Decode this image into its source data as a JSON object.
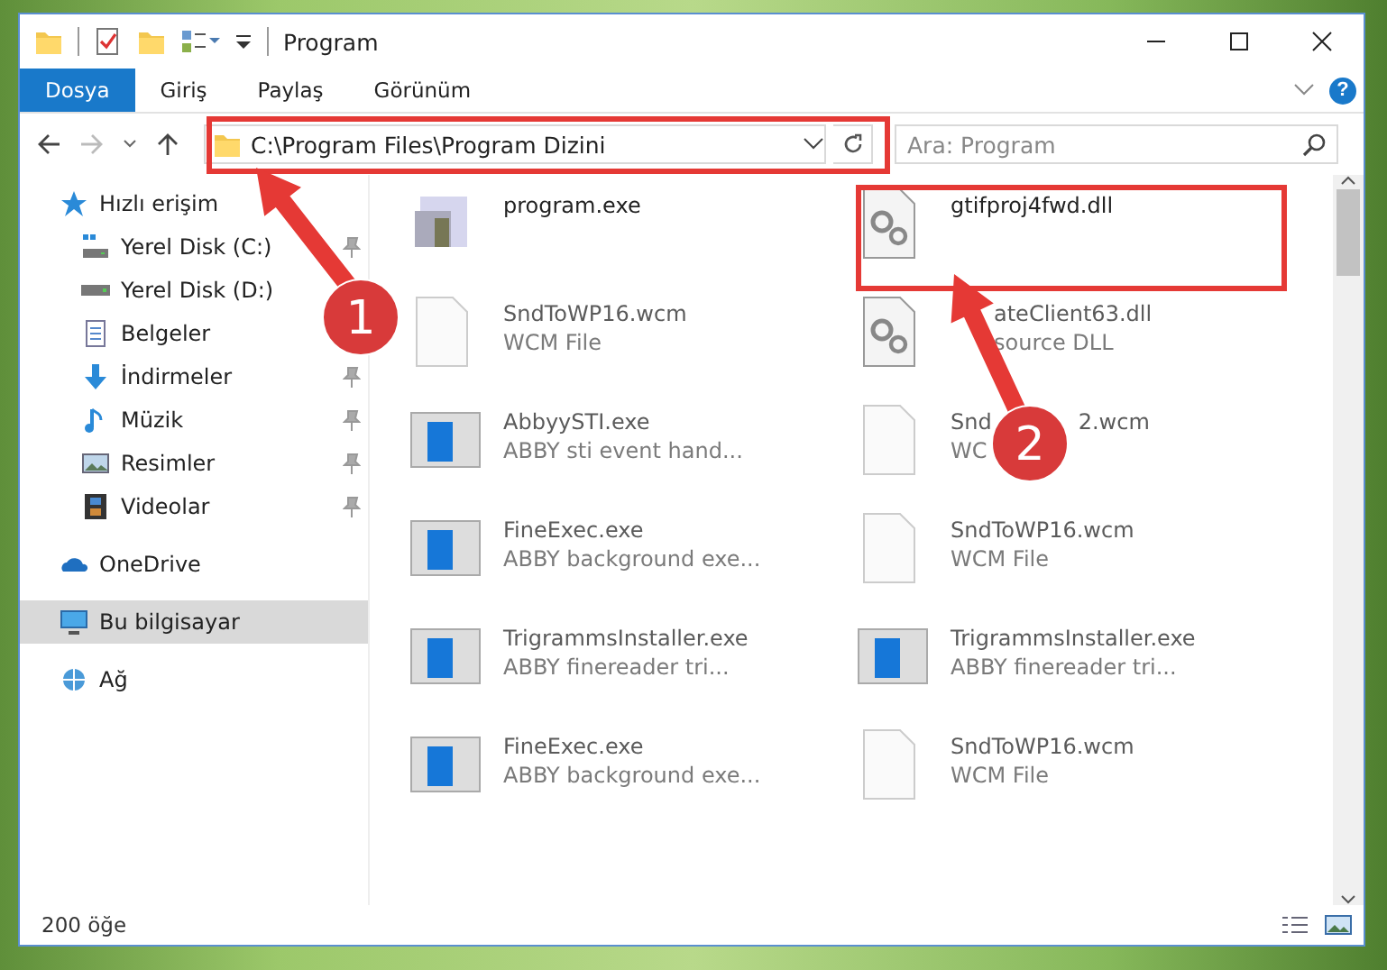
{
  "window": {
    "title": "Program"
  },
  "ribbon_tabs": [
    {
      "label": "Dosya",
      "selected": true
    },
    {
      "label": "Giriş",
      "selected": false
    },
    {
      "label": "Paylaş",
      "selected": false
    },
    {
      "label": "Görünüm",
      "selected": false
    }
  ],
  "help": "?",
  "address": {
    "path": "C:\\Program Files\\Program Dizini"
  },
  "search": {
    "placeholder": "Ara: Program"
  },
  "sidebar": {
    "groups": [
      {
        "label": "Hızlı erişim",
        "selected": false,
        "children": [
          {
            "label": "Yerel Disk (C:)",
            "pinned": true
          },
          {
            "label": "Yerel Disk (D:)"
          },
          {
            "label": "Belgeler"
          },
          {
            "label": "İndirmeler",
            "pinned": true
          },
          {
            "label": "Müzik",
            "pinned": true
          },
          {
            "label": "Resimler",
            "pinned": true
          },
          {
            "label": "Videolar",
            "pinned": true
          }
        ]
      },
      {
        "label": "OneDrive",
        "selected": false
      },
      {
        "label": "Bu bilgisayar",
        "selected": true
      },
      {
        "label": "Ağ",
        "selected": false
      }
    ]
  },
  "files": {
    "columns": [
      [
        {
          "kind": "installer",
          "name": "program.exe"
        },
        {
          "kind": "blank",
          "name": "SndToWP16.wcm",
          "detail": "WCM File"
        },
        {
          "kind": "app",
          "name": "AbbyySTI.exe",
          "detail": "ABBY sti event hand..."
        },
        {
          "kind": "app",
          "name": "FineExec.exe",
          "detail": "ABBY background exe..."
        },
        {
          "kind": "app",
          "name": "TrigrammsInstaller.exe",
          "detail": "ABBY finereader tri..."
        },
        {
          "kind": "app",
          "name": "FineExec.exe",
          "detail": "ABBY background exe..."
        }
      ],
      [
        {
          "kind": "dll",
          "name": "gtifproj4fwd.dll"
        },
        {
          "kind": "dll",
          "name": "ateClient63.dll",
          "detail": "source DLL"
        },
        {
          "kind": "blank",
          "name_parts": [
            "Snd",
            "2.wcm"
          ],
          "detail": "WC"
        },
        {
          "kind": "blank",
          "name": "SndToWP16.wcm",
          "detail": "WCM File"
        },
        {
          "kind": "app",
          "name": "TrigrammsInstaller.exe",
          "detail": "ABBY finereader tri..."
        },
        {
          "kind": "blank",
          "name": "SndToWP16.wcm",
          "detail": "WCM File"
        }
      ]
    ]
  },
  "status_bar": {
    "count": "200 öğe"
  },
  "annotations": [
    {
      "number": "1"
    },
    {
      "number": "2"
    }
  ]
}
